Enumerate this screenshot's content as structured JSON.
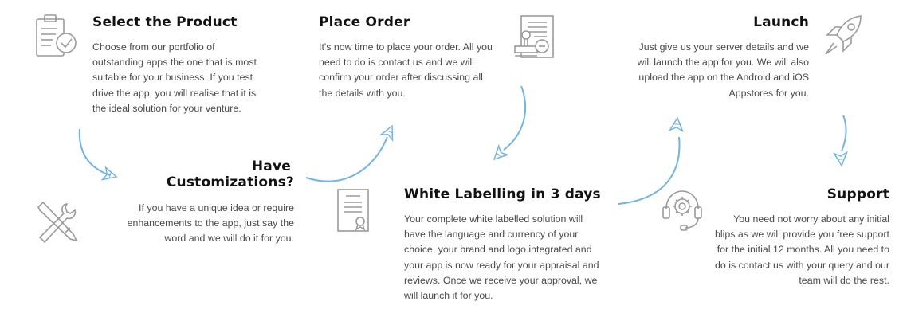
{
  "steps": {
    "select": {
      "title": "Select the Product",
      "desc": "Choose from our portfolio of outstanding apps the one that is most suitable for your business. If you test drive the app, you will realise that it is the ideal solution for your venture."
    },
    "custom": {
      "title_line1": "Have",
      "title_line2": "Customizations?",
      "desc": "If you have a unique idea or require enhancements to the app, just say the word and we will do it for you."
    },
    "order": {
      "title": "Place Order",
      "desc": "It's now time to place your order. All you need to do is contact us and we will confirm your order after discussing all the details with you."
    },
    "white": {
      "title": "White Labelling in 3 days",
      "desc": "Your complete white labelled solution will have the language and currency of your choice, your brand and logo integrated and your app is now ready for your appraisal and reviews. Once we receive your approval, we will launch it for you."
    },
    "launch": {
      "title": "Launch",
      "desc": "Just give us your server details and we will launch the app for you. We will also upload the app on the Android and iOS Appstores for you."
    },
    "support": {
      "title": "Support",
      "desc": "You need not worry about any initial blips as we will provide you free support for the initial 12 months. All you need to do is contact us with your query and our team will do the rest."
    }
  },
  "icons": [
    "clipboard-check-icon",
    "tools-icon",
    "order-stamp-icon",
    "certificate-icon",
    "rocket-icon",
    "support-headset-icon"
  ],
  "colors": {
    "arrow": "#6fb4e8",
    "icon": "#9a9a9a",
    "title": "#111111",
    "text": "#4a4a4a"
  }
}
